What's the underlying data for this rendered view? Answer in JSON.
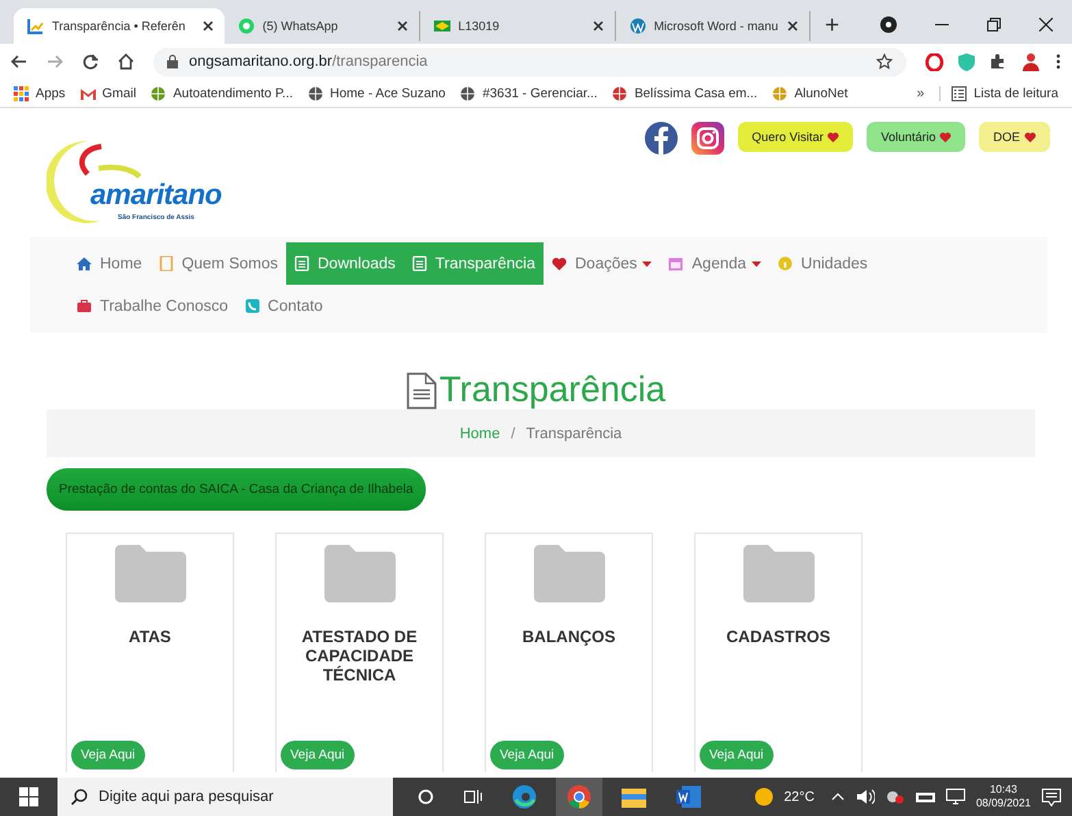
{
  "browser": {
    "tabs": [
      {
        "title": "Transparência • Referên",
        "selected": true
      },
      {
        "title": "(5) WhatsApp",
        "selected": false
      },
      {
        "title": "L13019",
        "selected": false
      },
      {
        "title": "Microsoft Word - manu",
        "selected": false
      }
    ],
    "new_tab": "+",
    "address": {
      "domain": "ongsamaritano.org.br",
      "path": "/transparencia"
    },
    "bookmarks": [
      "Apps",
      "Gmail",
      "Autoatendimento P...",
      "Home - Ace Suzano",
      "#3631 - Gerenciar...",
      "Belíssima Casa em...",
      "AlunoNet"
    ],
    "more_bookmarks": "»",
    "reading_list": "Lista de leitura"
  },
  "header": {
    "logo": {
      "name": "amaritano",
      "tagline": "São Francisco de Assis"
    },
    "actions": [
      {
        "label": "Quero Visitar",
        "color": "#e3ec3a"
      },
      {
        "label": "Voluntário",
        "color": "#8fe38a"
      },
      {
        "label": "DOE",
        "color": "#f3ef8c"
      }
    ]
  },
  "nav": {
    "rows": [
      {
        "items": [
          {
            "label": "Home",
            "selected": false,
            "dropdown": false
          },
          {
            "label": "Quem Somos",
            "selected": false,
            "dropdown": false
          },
          {
            "label": "Downloads",
            "selected": true,
            "dropdown": false
          },
          {
            "label": "Transparência",
            "selected": true,
            "dropdown": false
          },
          {
            "label": "Doações",
            "selected": false,
            "dropdown": true
          },
          {
            "label": "Agenda",
            "selected": false,
            "dropdown": true
          },
          {
            "label": "Unidades",
            "selected": false,
            "dropdown": false
          }
        ]
      },
      {
        "items": [
          {
            "label": "Trabalhe Conosco",
            "selected": false,
            "dropdown": false
          },
          {
            "label": "Contato",
            "selected": false,
            "dropdown": false
          }
        ]
      }
    ]
  },
  "page": {
    "title": "Transparência",
    "breadcrumb": {
      "link": "Home",
      "separator": "/",
      "current": "Transparência"
    },
    "notice": "Prestação de contas do SAICA - Casa da Criança de Ilhabela",
    "cards": [
      {
        "title": "ATAS",
        "button": "Veja Aqui"
      },
      {
        "title": "ATESTADO DE CAPACIDADE TÉCNICA",
        "button": "Veja Aqui"
      },
      {
        "title": "BALANÇOS",
        "button": "Veja Aqui"
      },
      {
        "title": "CADASTROS",
        "button": "Veja Aqui"
      }
    ]
  },
  "taskbar": {
    "search": {
      "placeholder": "Digite aqui para pesquisar"
    },
    "temperature": "22°C",
    "time": "10:43",
    "date": "08/09/2021"
  }
}
